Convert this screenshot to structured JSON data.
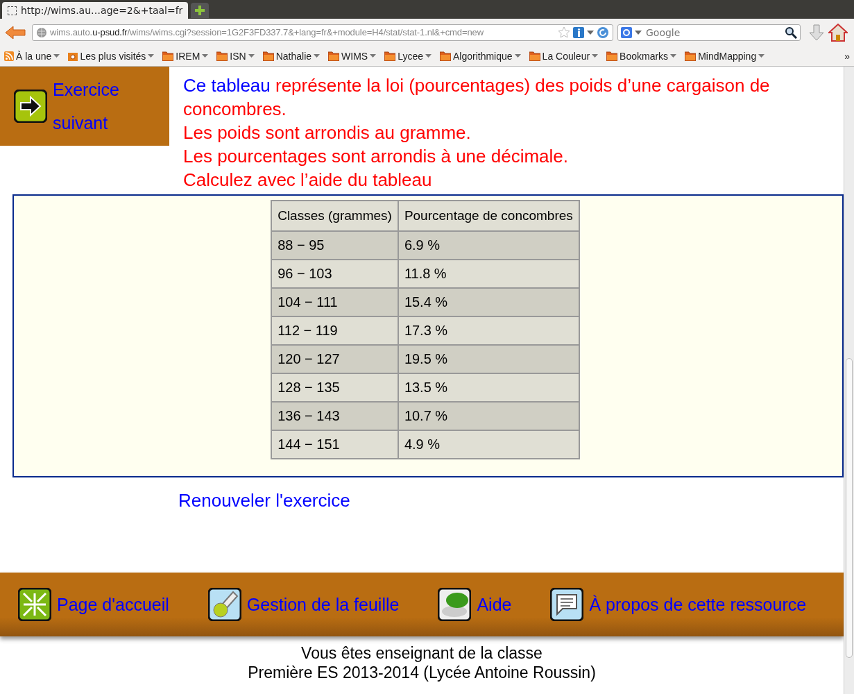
{
  "browser": {
    "tabs": [
      {
        "title": "http://wims.au…age=2&+taal=fr",
        "selected": true
      }
    ],
    "url": {
      "host_start": "wims.auto.",
      "host": "u-psud.fr",
      "path": "/wims/wims.cgi?session=1G2F3FD337.7&+lang=fr&+module=H4/stat/stat-1.nl&+cmd=new"
    },
    "search": {
      "placeholder": "Google"
    },
    "bookmarks": [
      {
        "label": "À la une",
        "kind": "feed"
      },
      {
        "label": "Les plus visités",
        "kind": "smart"
      },
      {
        "label": "IREM",
        "kind": "folder"
      },
      {
        "label": "ISN",
        "kind": "folder"
      },
      {
        "label": "Nathalie",
        "kind": "folder"
      },
      {
        "label": "WIMS",
        "kind": "folder"
      },
      {
        "label": "Lycee",
        "kind": "folder"
      },
      {
        "label": "Algorithmique",
        "kind": "folder"
      },
      {
        "label": "La Couleur",
        "kind": "folder"
      },
      {
        "label": "Bookmarks",
        "kind": "folder"
      },
      {
        "label": "MindMapping",
        "kind": "folder"
      }
    ],
    "overflow": "»"
  },
  "next_exercise": "Exercice suivant",
  "intro": {
    "link": "Ce tableau",
    "text": "représente la loi (pourcentages) des poids d’une cargaison de concombres.",
    "lines": [
      "Les poids sont arrondis au gramme.",
      "Les pourcentages sont arrondis à une décimale.",
      "Calculez avec l’aide du tableau"
    ]
  },
  "table": {
    "columns": [
      "Classes (grammes)",
      "Pourcentage de concombres"
    ],
    "rows": [
      [
        "88 − 95",
        "6.9 %"
      ],
      [
        "96 − 103",
        "11.8 %"
      ],
      [
        "104 − 111",
        "15.4 %"
      ],
      [
        "112 − 119",
        "17.3 %"
      ],
      [
        "120 − 127",
        "19.5 %"
      ],
      [
        "128 − 135",
        "13.5 %"
      ],
      [
        "136 − 143",
        "10.7 %"
      ],
      [
        "144 − 151",
        "4.9 %"
      ]
    ]
  },
  "renew": "Renouveler l'exercice",
  "footer_links": [
    {
      "label": "Page d'accueil",
      "kind": "home"
    },
    {
      "label": "Gestion de la feuille",
      "kind": "tools"
    },
    {
      "label": "Aide",
      "kind": "help"
    },
    {
      "label": "À propos de cette ressource",
      "kind": "about"
    }
  ],
  "status": [
    "Vous êtes enseignant de la classe",
    "Première ES 2013-2014 (Lycée Antoine Roussin)"
  ]
}
